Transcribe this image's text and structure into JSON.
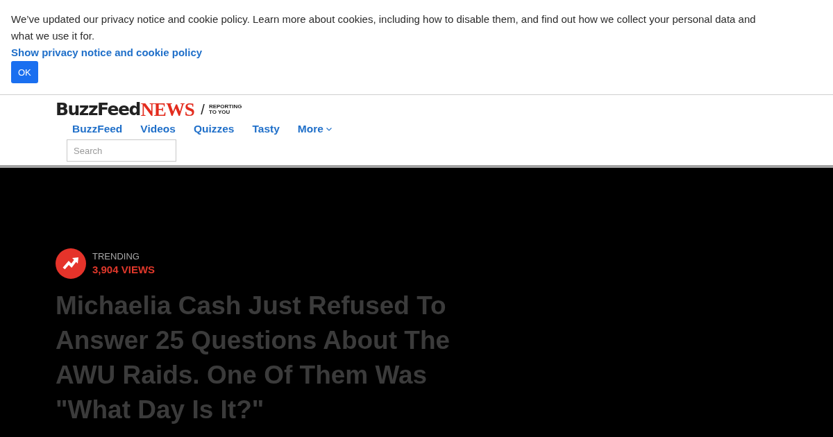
{
  "cookie_banner": {
    "message": "We’ve updated our privacy notice and cookie policy. Learn more about cookies, including how to disable them, and find out how we collect your personal data and what we use it for.",
    "link": "Show privacy notice and cookie policy",
    "button": "OK"
  },
  "header": {
    "logo": {
      "brand": "BuzzFeed",
      "section": "NEWS",
      "separator": "/",
      "tagline": [
        "REPORTING",
        "TO YOU"
      ]
    },
    "nav": [
      {
        "label": "BuzzFeed",
        "kind": "link"
      },
      {
        "label": "Videos",
        "kind": "link"
      },
      {
        "label": "Quizzes",
        "kind": "link"
      },
      {
        "label": "Tasty",
        "kind": "link"
      },
      {
        "label": "More",
        "kind": "dropdown"
      }
    ],
    "search": {
      "placeholder": "Search"
    }
  },
  "article": {
    "badge": {
      "label": "TRENDING",
      "views": "3,904 VIEWS"
    },
    "headline": "Michaelia Cash Just Refused To Answer 25 Questions About The AWU Raids. One Of Them Was \"What Day Is It?\""
  }
}
